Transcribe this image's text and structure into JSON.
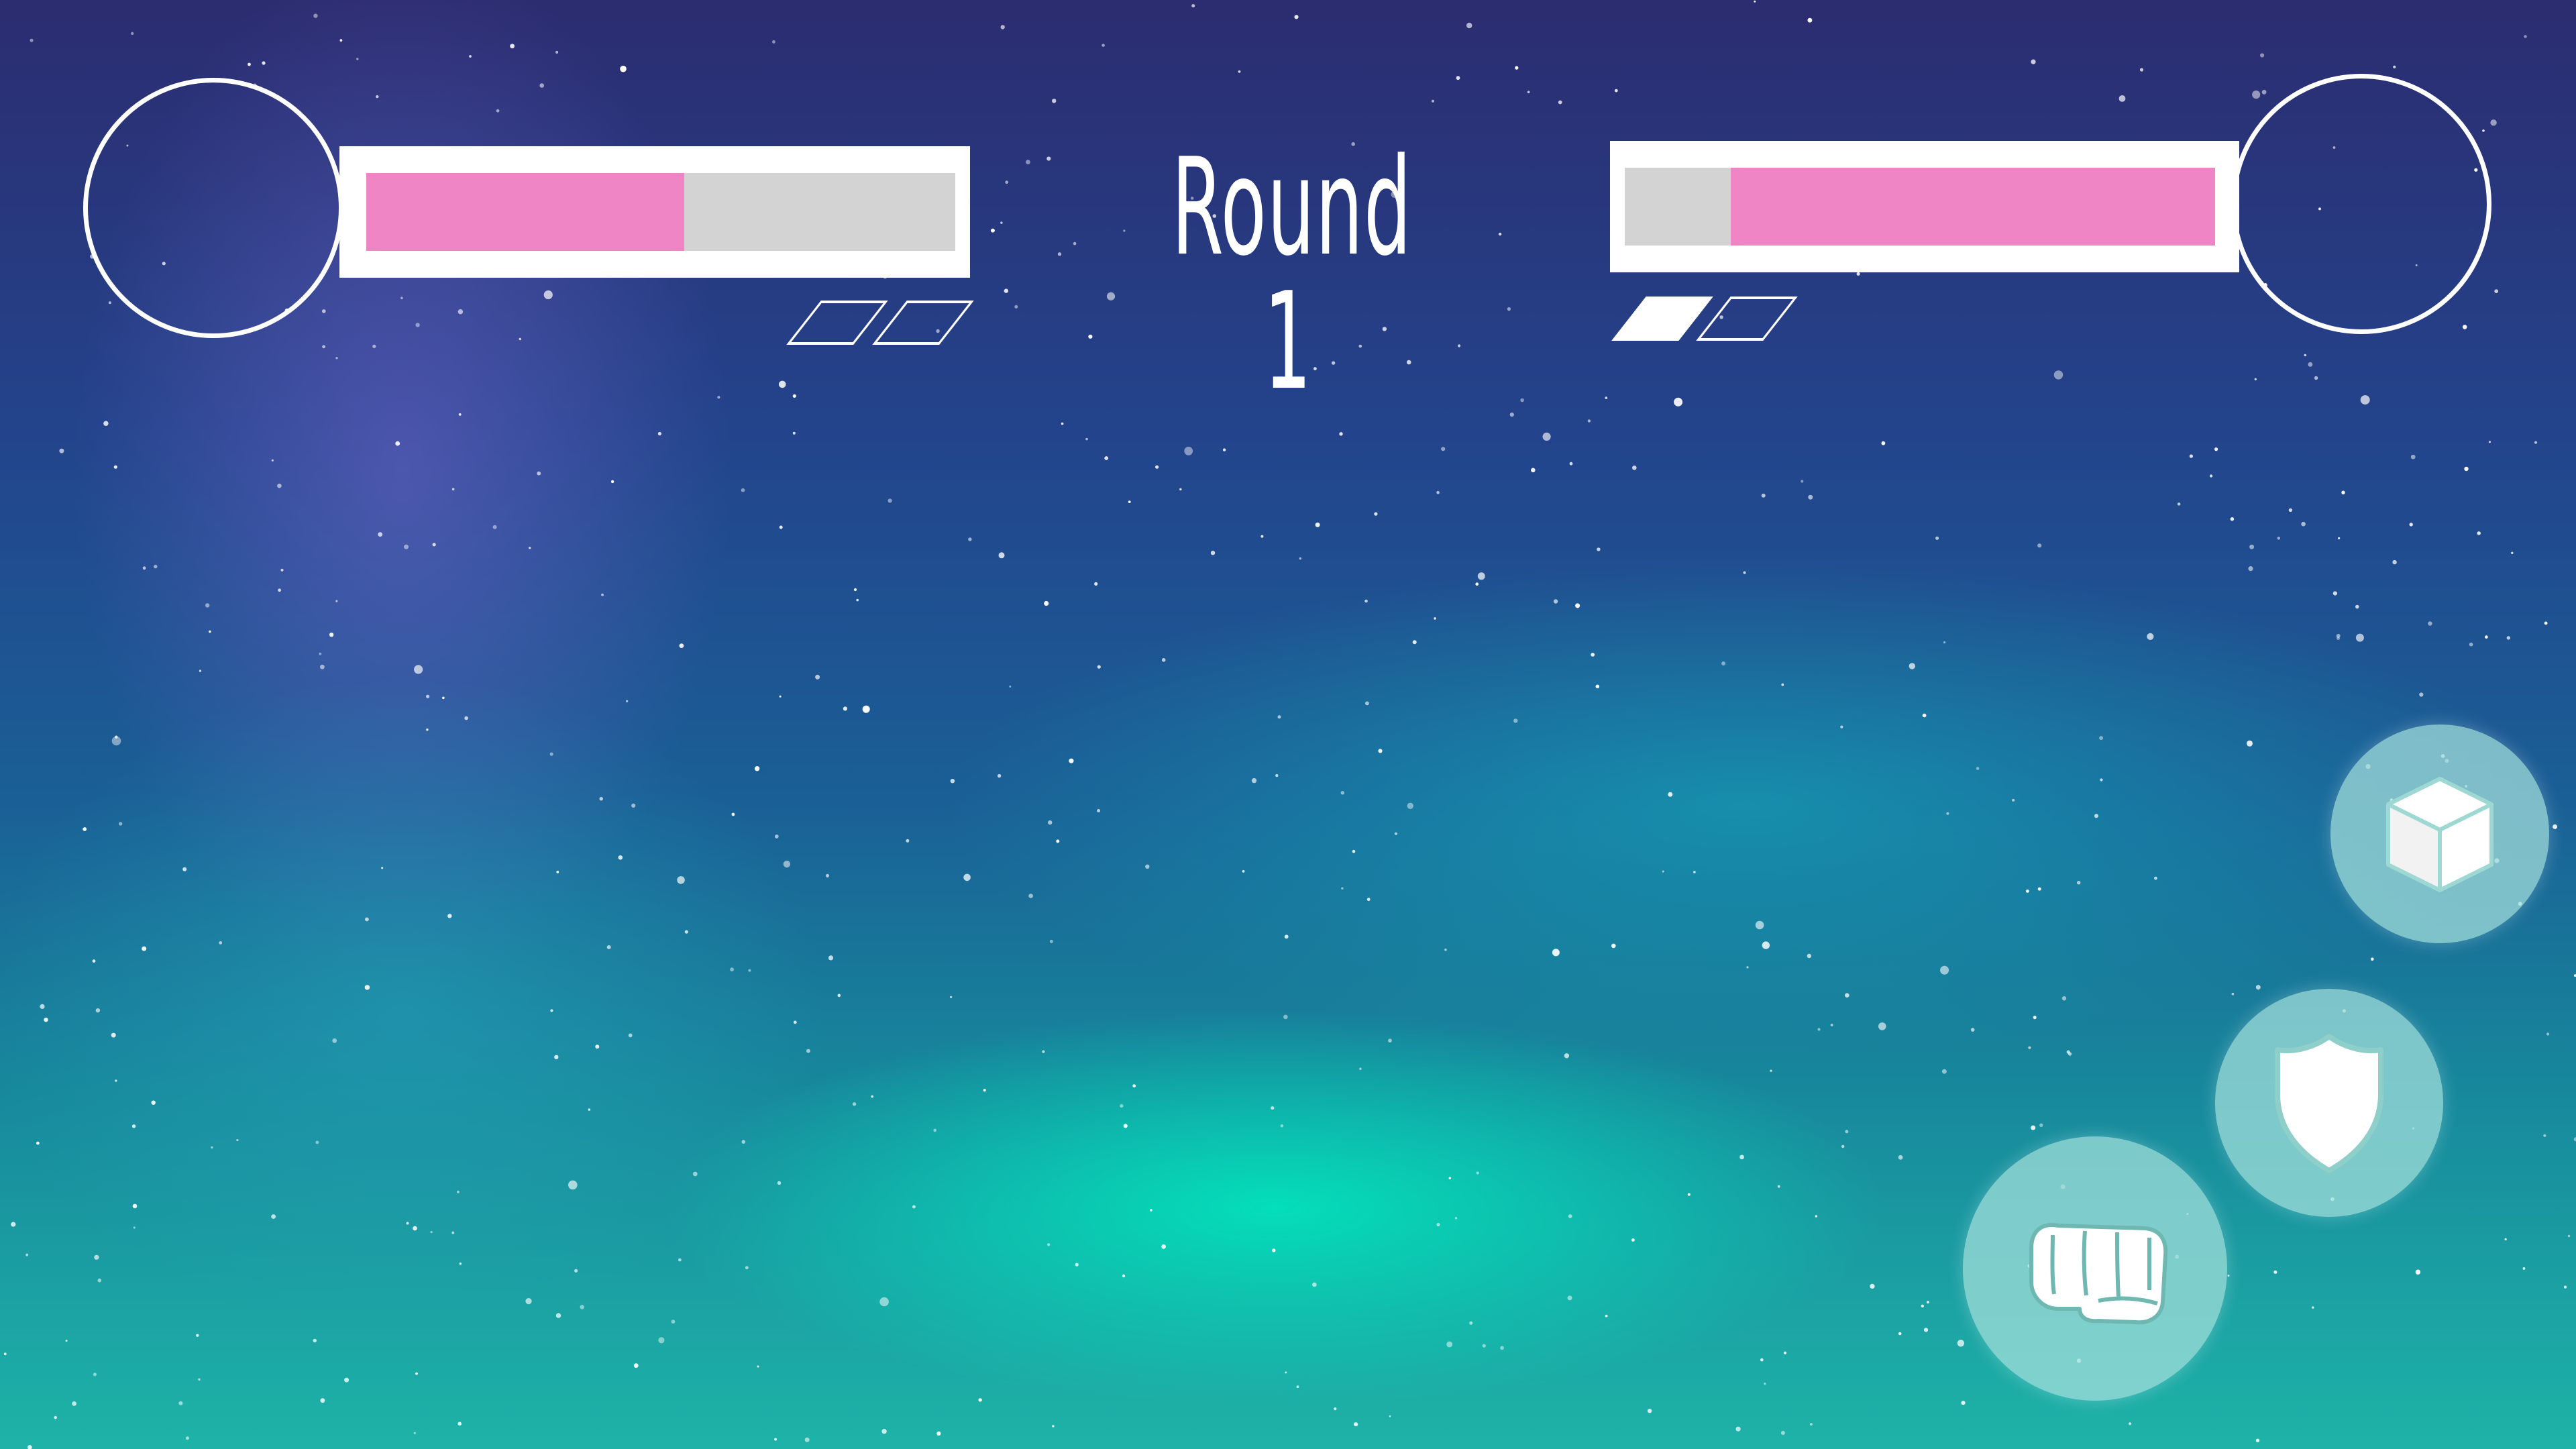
{
  "hud": {
    "round_label": "Round 1",
    "player1": {
      "health": 0.54,
      "rounds_won": 0,
      "rounds_total": 2
    },
    "player2": {
      "health": 0.82,
      "rounds_won": 1,
      "rounds_total": 2
    }
  },
  "actions": [
    {
      "id": "item",
      "icon": "cube-icon"
    },
    {
      "id": "block",
      "icon": "shield-icon"
    },
    {
      "id": "punch",
      "icon": "fist-icon"
    }
  ],
  "colors": {
    "health_fill": "#ef85c5",
    "health_empty": "#d3d3d3",
    "hud_frame": "#ffffff",
    "button_bg": "#a5e1dc"
  }
}
